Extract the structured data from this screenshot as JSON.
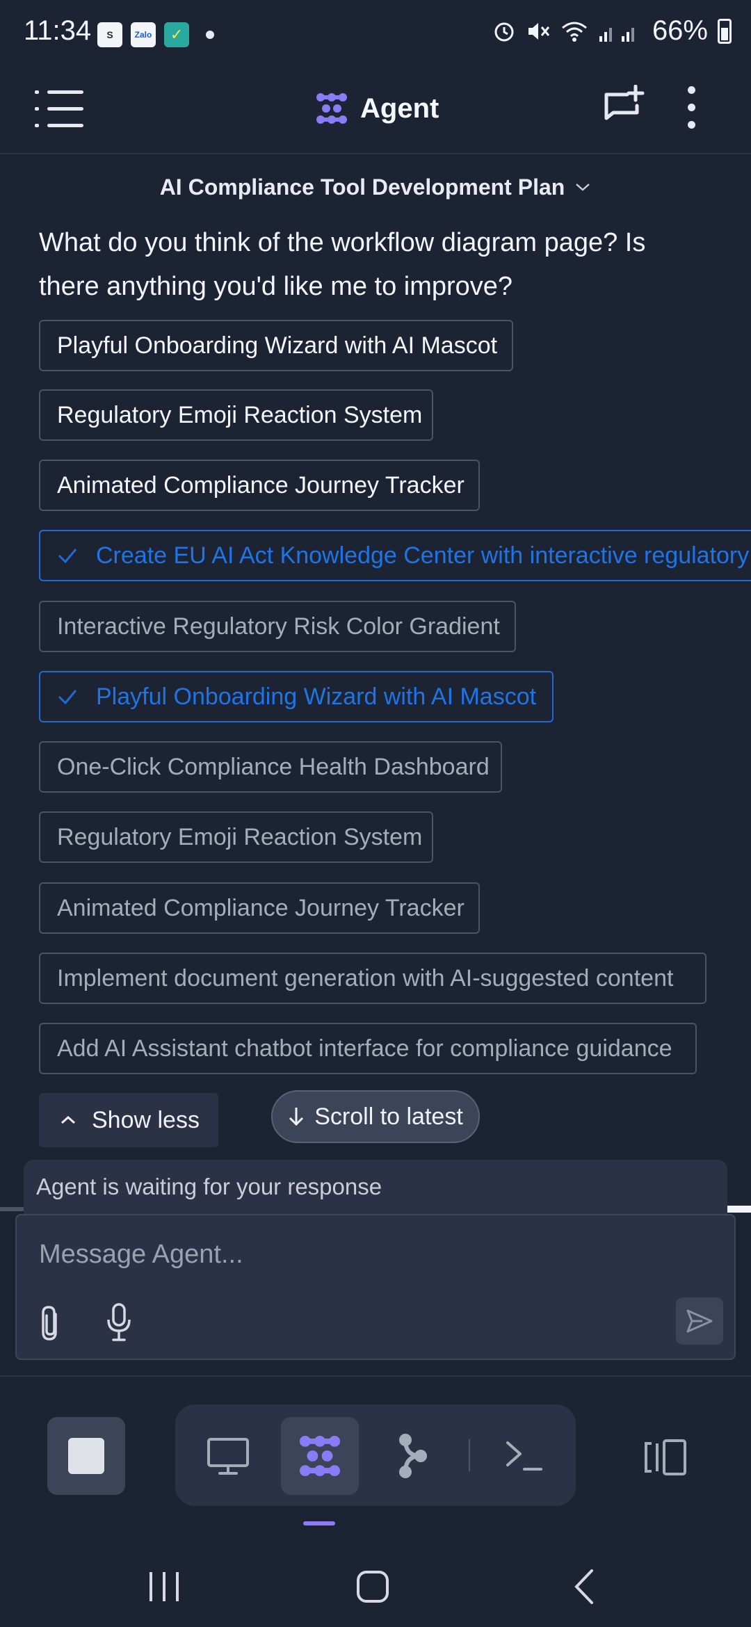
{
  "status_bar": {
    "time": "11:34",
    "apps": [
      "S",
      "Zalo",
      "✓"
    ],
    "battery": "66%"
  },
  "header": {
    "title": "Agent"
  },
  "conversation": {
    "title": "AI Compliance Tool Development Plan",
    "question": "What do you think of the workflow diagram page? Is there anything you'd like me to improve?",
    "options": [
      {
        "label": "Playful Onboarding Wizard with AI Mascot",
        "state": "bright"
      },
      {
        "label": "Regulatory Emoji Reaction System",
        "state": "bright"
      },
      {
        "label": "Animated Compliance Journey Tracker",
        "state": "bright"
      },
      {
        "label": "Create EU AI Act Knowledge Center with interactive regulatory",
        "state": "selected"
      },
      {
        "label": "Interactive Regulatory Risk Color Gradient",
        "state": "dim"
      },
      {
        "label": "Playful Onboarding Wizard with AI Mascot",
        "state": "selected"
      },
      {
        "label": "One-Click Compliance Health Dashboard",
        "state": "dim"
      },
      {
        "label": "Regulatory Emoji Reaction System",
        "state": "dim"
      },
      {
        "label": "Animated Compliance Journey Tracker",
        "state": "dim"
      },
      {
        "label": "Implement document generation with AI-suggested content",
        "state": "dim"
      },
      {
        "label": "Add AI Assistant chatbot interface for compliance guidance",
        "state": "dim"
      }
    ],
    "show_less_label": "Show less",
    "scroll_latest_label": "Scroll to latest"
  },
  "composer": {
    "waiting_text": "Agent is waiting for your response",
    "placeholder": "Message Agent..."
  },
  "colors": {
    "background": "#1c2333",
    "surface": "#2b3245",
    "accent": "#8a7cf6",
    "selected": "#1f6ad6"
  },
  "icons": {
    "menu": "hamburger-icon",
    "logo": "agent-logo-icon",
    "new_chat": "new-chat-icon",
    "more": "kebab-icon",
    "chevron": "chevron-down-icon",
    "attach": "paperclip-icon",
    "mic": "microphone-icon",
    "send": "send-icon"
  }
}
